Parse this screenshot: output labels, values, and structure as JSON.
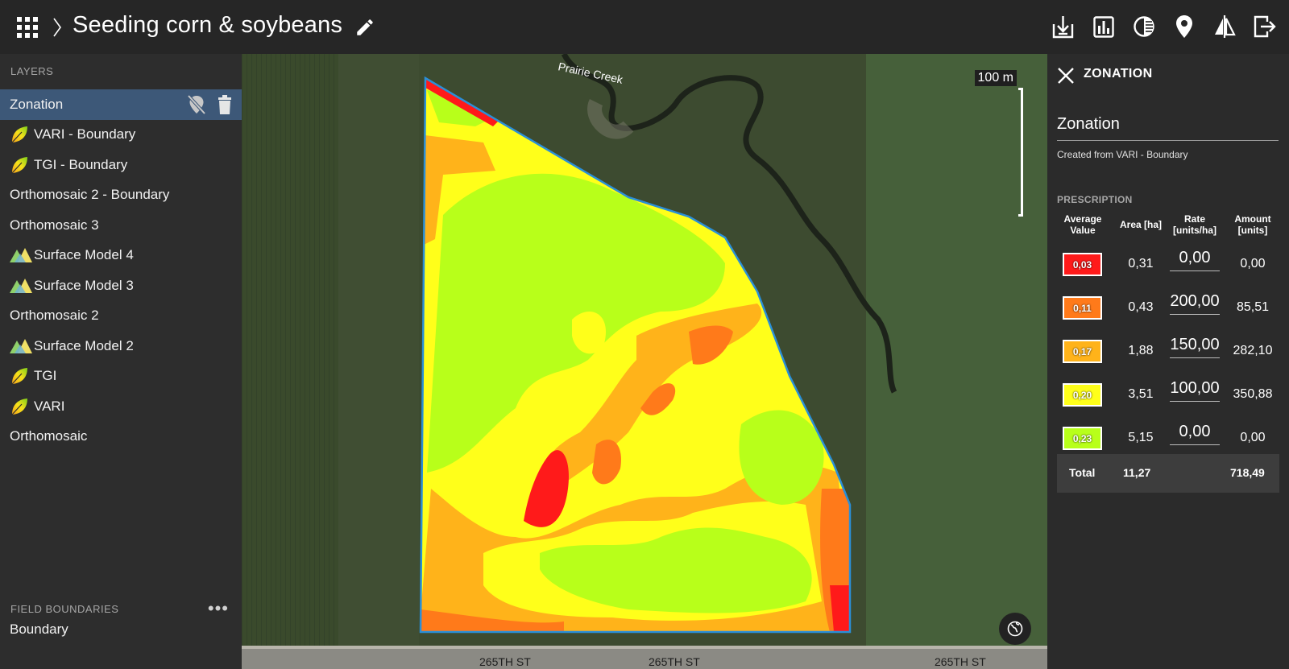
{
  "header": {
    "title": "Seeding corn & soybeans",
    "toolbar_icons": [
      "download-icon",
      "report-icon",
      "compare-icon",
      "location-icon",
      "split-view-icon",
      "logout-icon"
    ]
  },
  "layers_panel": {
    "heading": "LAYERS",
    "items": [
      {
        "label": "Zonation",
        "icon": "",
        "active": true
      },
      {
        "label": "VARI - Boundary",
        "icon": "leaf-icon"
      },
      {
        "label": "TGI - Boundary",
        "icon": "leaf-icon"
      },
      {
        "label": "Orthomosaic 2 - Boundary",
        "icon": ""
      },
      {
        "label": "Orthomosaic 3",
        "icon": ""
      },
      {
        "label": "Surface Model 4",
        "icon": "mountain-icon"
      },
      {
        "label": "Surface Model 3",
        "icon": "mountain-icon"
      },
      {
        "label": "Orthomosaic 2",
        "icon": ""
      },
      {
        "label": "Surface Model 2",
        "icon": "mountain-icon"
      },
      {
        "label": "TGI",
        "icon": "leaf-icon"
      },
      {
        "label": "VARI",
        "icon": "leaf-icon"
      },
      {
        "label": "Orthomosaic",
        "icon": ""
      }
    ],
    "field_boundaries_heading": "FIELD BOUNDARIES",
    "more_label": "•••",
    "boundary_item": "Boundary"
  },
  "map": {
    "scale_label": "100 m",
    "creek_label": "Prairie Creek",
    "road_label": "265TH ST",
    "zone_colors": {
      "red": "#ff1a1a",
      "orange": "#ff7a1a",
      "amber": "#ffb31a",
      "yellow": "#ffff1a",
      "green": "#b8ff1a"
    }
  },
  "zonation_panel": {
    "title": "ZONATION",
    "zone_name": "Zonation",
    "created_from": "Created from VARI - Boundary",
    "prescription_heading": "PRESCRIPTION",
    "columns": {
      "avg_value_1": "Average",
      "avg_value_2": "Value",
      "area": "Area [ha]",
      "rate_1": "Rate",
      "rate_2": "[units/ha]",
      "amount_1": "Amount",
      "amount_2": "[units]"
    },
    "rows": [
      {
        "value": "0,03",
        "color": "#ff1a1a",
        "area": "0,31",
        "rate": "0,00",
        "amount": "0,00"
      },
      {
        "value": "0,11",
        "color": "#ff7a1a",
        "area": "0,43",
        "rate": "200,00",
        "amount": "85,51"
      },
      {
        "value": "0,17",
        "color": "#ffb31a",
        "area": "1,88",
        "rate": "150,00",
        "amount": "282,10"
      },
      {
        "value": "0,20",
        "color": "#ffff1a",
        "area": "3,51",
        "rate": "100,00",
        "amount": "350,88"
      },
      {
        "value": "0,23",
        "color": "#b8ff1a",
        "area": "5,15",
        "rate": "0,00",
        "amount": "0,00"
      }
    ],
    "total": {
      "label": "Total",
      "area": "11,27",
      "amount": "718,49"
    }
  }
}
